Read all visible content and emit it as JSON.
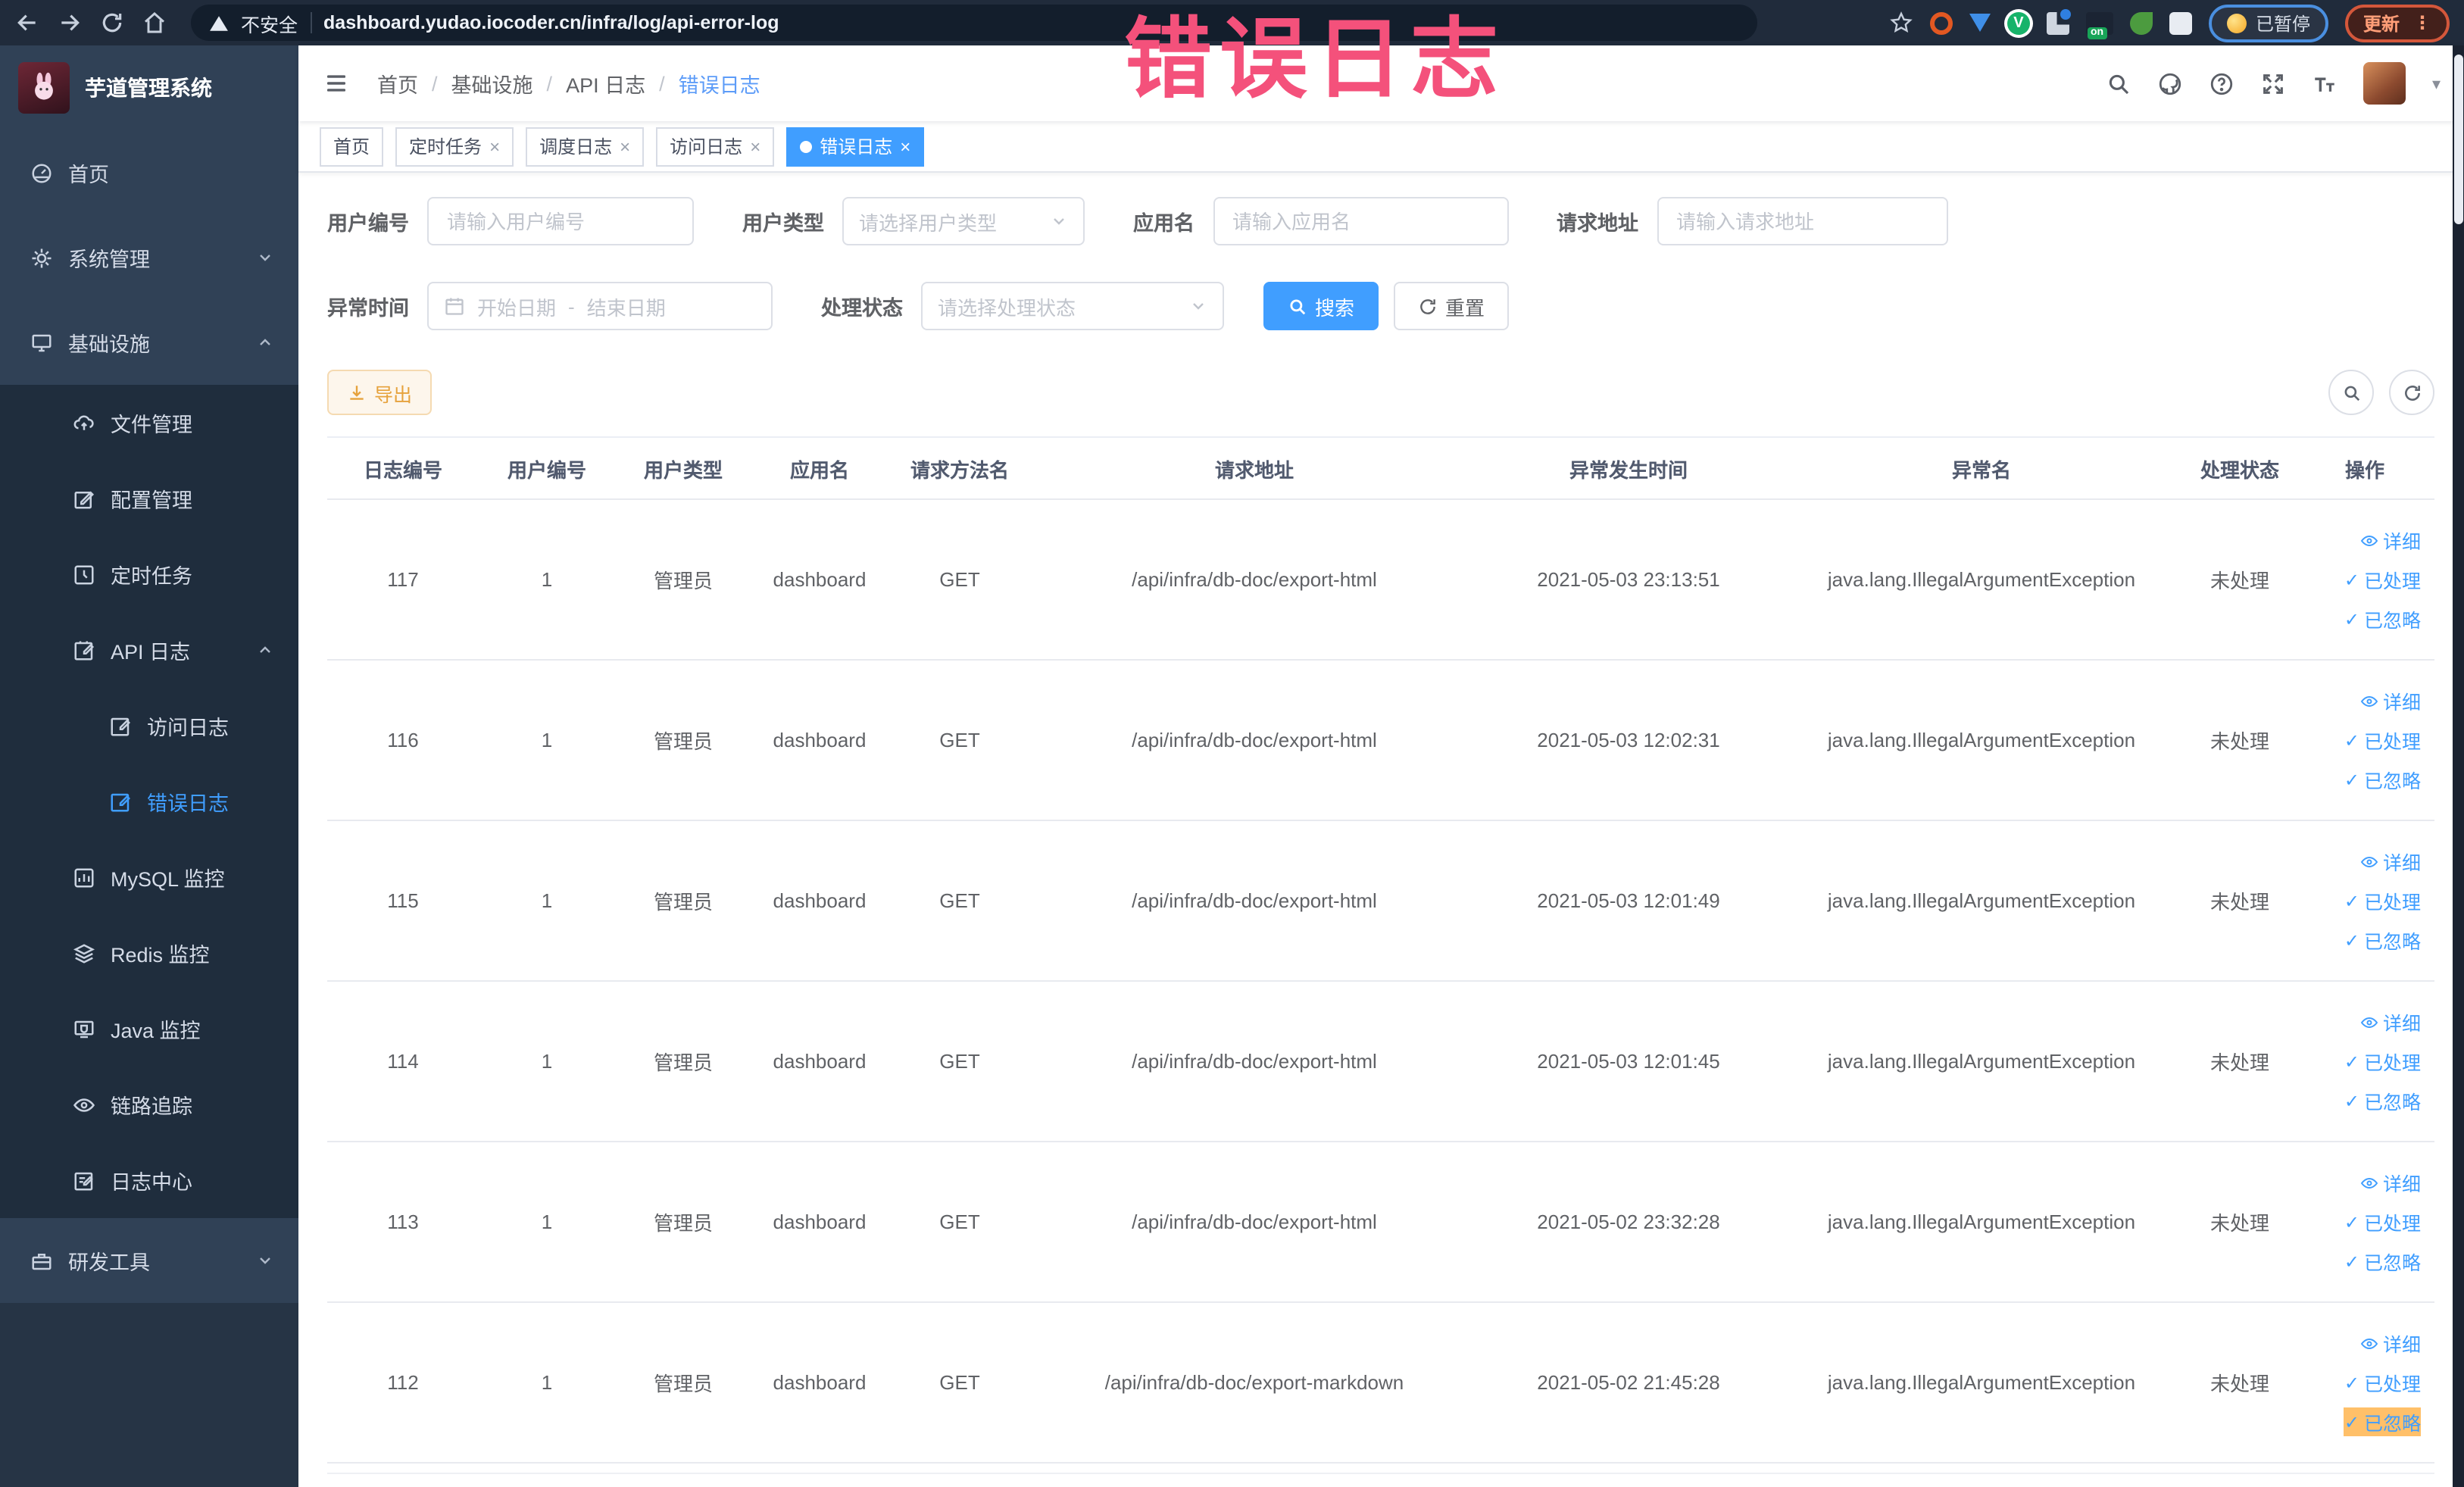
{
  "colors": {
    "primary": "#409EFF",
    "link": "#409EFF",
    "warning_text": "#E6A23C",
    "warning_bg": "#FDF6EC",
    "warning_border": "#F5DAB1",
    "annotation_pink": "#F4517B",
    "sidebar_bg": "#304156",
    "sidebar_submenu_bg": "#1F2D3D",
    "toolbar_bg": "#202B3B"
  },
  "icons": {
    "close": "×",
    "check": "✓",
    "dots": "⋮",
    "caret": "▾",
    "slash": "/",
    "dash": "-",
    "question": "?",
    "on_badge": "on",
    "t_big": "T",
    "t_small": "T"
  },
  "browser": {
    "security_label": "不安全",
    "url": "dashboard.yudao.iocoder.cn/infra/log/api-error-log",
    "paused_badge": "已暂停",
    "update_button": "更新"
  },
  "annotation": {
    "text": "错误日志"
  },
  "sidebar": {
    "title": "芋道管理系统",
    "items": [
      {
        "label": "首页"
      },
      {
        "label": "系统管理"
      },
      {
        "label": "基础设施"
      },
      {
        "label": "文件管理"
      },
      {
        "label": "配置管理"
      },
      {
        "label": "定时任务"
      },
      {
        "label": "API 日志"
      },
      {
        "label": "访问日志"
      },
      {
        "label": "错误日志"
      },
      {
        "label": "MySQL 监控"
      },
      {
        "label": "Redis 监控"
      },
      {
        "label": "Java 监控"
      },
      {
        "label": "链路追踪"
      },
      {
        "label": "日志中心"
      },
      {
        "label": "研发工具"
      }
    ]
  },
  "navbar": {
    "breadcrumb": [
      "首页",
      "基础设施",
      "API 日志",
      "错误日志"
    ]
  },
  "tags_view": {
    "tabs": [
      {
        "label": "首页"
      },
      {
        "label": "定时任务"
      },
      {
        "label": "调度日志"
      },
      {
        "label": "访问日志"
      },
      {
        "label": "错误日志"
      }
    ]
  },
  "filters": {
    "user_id_label": "用户编号",
    "user_id_placeholder": "请输入用户编号",
    "user_type_label": "用户类型",
    "user_type_placeholder": "请选择用户类型",
    "app_name_label": "应用名",
    "app_name_placeholder": "请输入应用名",
    "request_url_label": "请求地址",
    "request_url_placeholder": "请输入请求地址",
    "exception_time_label": "异常时间",
    "start_date_placeholder": "开始日期",
    "end_date_placeholder": "结束日期",
    "process_status_label": "处理状态",
    "process_status_placeholder": "请选择处理状态",
    "search_button": "搜索",
    "reset_button": "重置"
  },
  "toolbar": {
    "export_button": "导出"
  },
  "table": {
    "columns": [
      "日志编号",
      "用户编号",
      "用户类型",
      "应用名",
      "请求方法名",
      "请求地址",
      "异常发生时间",
      "异常名",
      "处理状态",
      "操作"
    ],
    "actions": [
      "详细",
      "已处理",
      "已忽略"
    ],
    "rows": [
      {
        "id": "117",
        "user_id": "1",
        "user_type": "管理员",
        "app_name": "dashboard",
        "method": "GET",
        "url": "/api/infra/db-doc/export-html",
        "time": "2021-05-03 23:13:51",
        "exception": "java.lang.IllegalArgumentException",
        "status": "未处理"
      },
      {
        "id": "116",
        "user_id": "1",
        "user_type": "管理员",
        "app_name": "dashboard",
        "method": "GET",
        "url": "/api/infra/db-doc/export-html",
        "time": "2021-05-03 12:02:31",
        "exception": "java.lang.IllegalArgumentException",
        "status": "未处理"
      },
      {
        "id": "115",
        "user_id": "1",
        "user_type": "管理员",
        "app_name": "dashboard",
        "method": "GET",
        "url": "/api/infra/db-doc/export-html",
        "time": "2021-05-03 12:01:49",
        "exception": "java.lang.IllegalArgumentException",
        "status": "未处理"
      },
      {
        "id": "114",
        "user_id": "1",
        "user_type": "管理员",
        "app_name": "dashboard",
        "method": "GET",
        "url": "/api/infra/db-doc/export-html",
        "time": "2021-05-03 12:01:45",
        "exception": "java.lang.IllegalArgumentException",
        "status": "未处理"
      },
      {
        "id": "113",
        "user_id": "1",
        "user_type": "管理员",
        "app_name": "dashboard",
        "method": "GET",
        "url": "/api/infra/db-doc/export-html",
        "time": "2021-05-02 23:32:28",
        "exception": "java.lang.IllegalArgumentException",
        "status": "未处理"
      },
      {
        "id": "112",
        "user_id": "1",
        "user_type": "管理员",
        "app_name": "dashboard",
        "method": "GET",
        "url": "/api/infra/db-doc/export-markdown",
        "time": "2021-05-02 21:45:28",
        "exception": "java.lang.IllegalArgumentException",
        "status": "未处理"
      }
    ]
  }
}
